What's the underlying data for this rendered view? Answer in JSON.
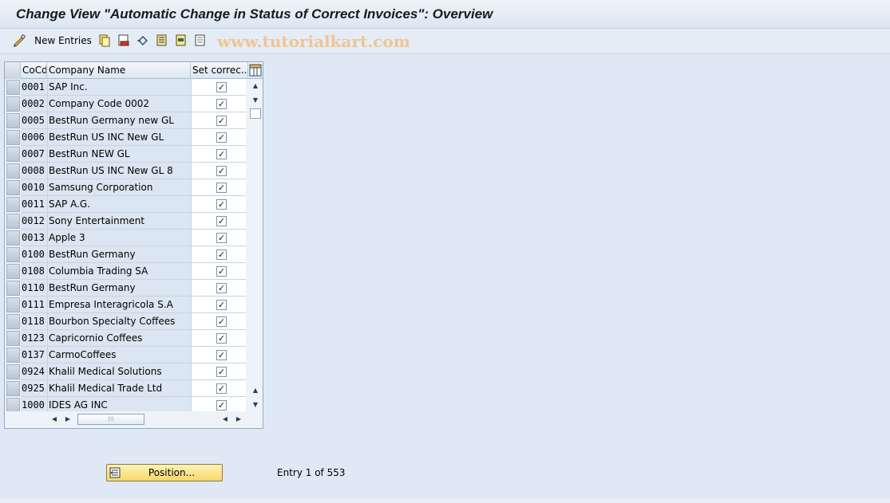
{
  "window": {
    "title": "Change View \"Automatic Change in Status of Correct Invoices\": Overview"
  },
  "toolbar": {
    "new_entries_label": "New Entries",
    "icons": [
      "pencil-glasses-icon",
      "copy-icon",
      "delete-icon",
      "undo-icon",
      "select-all-icon",
      "select-block-icon",
      "deselect-all-icon"
    ]
  },
  "watermark": "www.tutorialkart.com",
  "table": {
    "columns": [
      "CoCd",
      "Company Name",
      "Set correc..."
    ],
    "rows": [
      {
        "code": "0001",
        "name": "SAP Inc.",
        "checked": "✓"
      },
      {
        "code": "0002",
        "name": "Company Code 0002",
        "checked": "✓"
      },
      {
        "code": "0005",
        "name": "BestRun Germany new GL",
        "checked": "✓"
      },
      {
        "code": "0006",
        "name": "BestRun US INC New GL",
        "checked": "✓"
      },
      {
        "code": "0007",
        "name": "BestRun NEW GL",
        "checked": "✓"
      },
      {
        "code": "0008",
        "name": "BestRun US INC New GL 8",
        "checked": "✓"
      },
      {
        "code": "0010",
        "name": "Samsung Corporation",
        "checked": "✓"
      },
      {
        "code": "0011",
        "name": "SAP A.G.",
        "checked": "✓"
      },
      {
        "code": "0012",
        "name": "Sony Entertainment",
        "checked": "✓"
      },
      {
        "code": "0013",
        "name": "Apple 3",
        "checked": "✓"
      },
      {
        "code": "0100",
        "name": "BestRun Germany",
        "checked": "✓"
      },
      {
        "code": "0108",
        "name": "Columbia Trading SA",
        "checked": "✓"
      },
      {
        "code": "0110",
        "name": "BestRun Germany",
        "checked": "✓"
      },
      {
        "code": "0111",
        "name": "Empresa Interagricola S.A",
        "checked": "✓"
      },
      {
        "code": "0118",
        "name": "Bourbon Specialty Coffees",
        "checked": "✓"
      },
      {
        "code": "0123",
        "name": "Capricornio Coffees",
        "checked": "✓"
      },
      {
        "code": "0137",
        "name": "CarmoCoffees",
        "checked": "✓"
      },
      {
        "code": "0924",
        "name": "Khalil Medical Solutions",
        "checked": "✓"
      },
      {
        "code": "0925",
        "name": "Khalil Medical Trade Ltd",
        "checked": "✓"
      },
      {
        "code": "1000",
        "name": "IDES AG INC",
        "checked": "✓"
      }
    ]
  },
  "footer": {
    "position_label": "Position...",
    "entry_text": "Entry 1 of 553"
  }
}
